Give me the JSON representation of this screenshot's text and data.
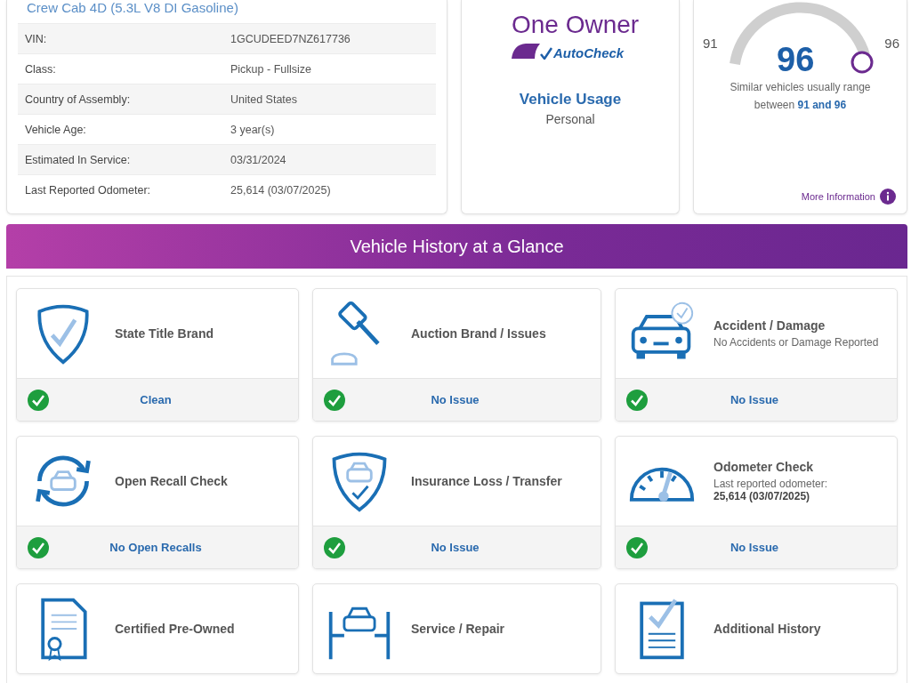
{
  "vehicle": {
    "subtitle": "Crew Cab 4D (5.3L V8 DI Gasoline)",
    "rows": [
      {
        "label": "VIN:",
        "value": "1GCUDEED7NZ617736"
      },
      {
        "label": "Class:",
        "value": "Pickup - Fullsize"
      },
      {
        "label": "Country of Assembly:",
        "value": "United States"
      },
      {
        "label": "Vehicle Age:",
        "value": "3 year(s)"
      },
      {
        "label": "Estimated In Service:",
        "value": "03/31/2024"
      },
      {
        "label": "Last Reported Odometer:",
        "value": "25,614 (03/07/2025)"
      }
    ]
  },
  "owner": {
    "logo_title": "One Owner",
    "logo_brand": "AutoCheck",
    "usage_label": "Vehicle Usage",
    "usage_value": "Personal"
  },
  "score": {
    "min_label": "91",
    "max_label": "96",
    "score": "96",
    "range_text": "Similar vehicles usually range",
    "range_prefix": "between",
    "range_values": "91 and 96",
    "more_link": "More Information"
  },
  "glance": {
    "title": "Vehicle History at a Glance",
    "cards": [
      {
        "title": "State Title Brand",
        "status": "Clean",
        "passed": true
      },
      {
        "title": "Auction Brand / Issues",
        "status": "No Issue",
        "passed": true
      },
      {
        "title": "Accident / Damage",
        "note": "No Accidents or Damage Reported",
        "status": "No Issue",
        "passed": true
      },
      {
        "title": "Open Recall Check",
        "status": "No Open Recalls",
        "passed": true
      },
      {
        "title": "Insurance Loss / Transfer",
        "status": "No Issue",
        "passed": true
      },
      {
        "title": "Odometer Check",
        "note": "Last reported odometer:",
        "note_value": "25,614 (03/07/2025)",
        "status": "No Issue",
        "passed": true
      },
      {
        "title": "Certified Pre-Owned"
      },
      {
        "title": "Service / Repair"
      },
      {
        "title": "Additional History"
      }
    ]
  }
}
